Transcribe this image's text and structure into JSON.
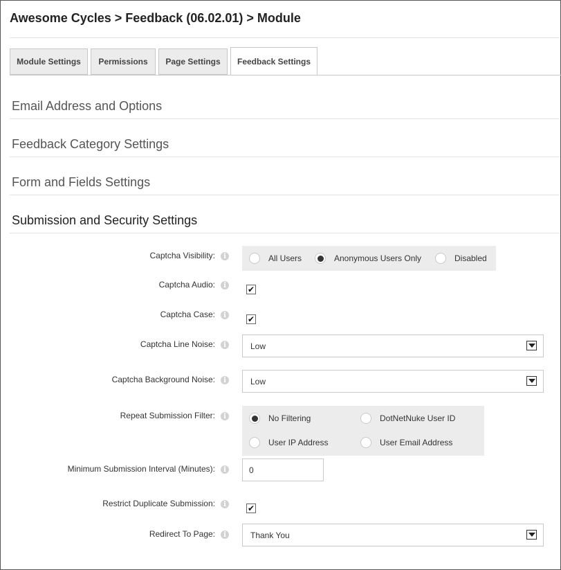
{
  "header": {
    "title": "Awesome Cycles > Feedback (06.02.01) > Module"
  },
  "tabs": [
    {
      "label": "Module Settings"
    },
    {
      "label": "Permissions"
    },
    {
      "label": "Page Settings"
    },
    {
      "label": "Feedback Settings",
      "active": true
    }
  ],
  "sections": [
    {
      "label": "Email Address and Options"
    },
    {
      "label": "Feedback Category Settings"
    },
    {
      "label": "Form and Fields Settings"
    },
    {
      "label": "Submission and Security Settings",
      "expanded": true
    }
  ],
  "form": {
    "captcha_visibility": {
      "label": "Captcha Visibility:",
      "options": [
        "All Users",
        "Anonymous Users Only",
        "Disabled"
      ],
      "selected": "Anonymous Users Only"
    },
    "captcha_audio": {
      "label": "Captcha Audio:",
      "checked": true
    },
    "captcha_case": {
      "label": "Captcha Case:",
      "checked": true
    },
    "captcha_line_noise": {
      "label": "Captcha Line Noise:",
      "value": "Low"
    },
    "captcha_background_noise": {
      "label": "Captcha Background Noise:",
      "value": "Low"
    },
    "repeat_submission_filter": {
      "label": "Repeat Submission Filter:",
      "options": [
        "No Filtering",
        "DotNetNuke User ID",
        "User IP Address",
        "User Email Address"
      ],
      "selected": "No Filtering"
    },
    "minimum_submission_interval": {
      "label": "Minimum Submission Interval (Minutes):",
      "value": "0"
    },
    "restrict_duplicate_submission": {
      "label": "Restrict Duplicate Submission:",
      "checked": true
    },
    "redirect_to_page": {
      "label": "Redirect To Page:",
      "value": "Thank You"
    }
  },
  "icons": {
    "info": "info-icon",
    "checkmark": "✔"
  },
  "colors": {
    "group_bg": "#ececec",
    "border": "#c9c9c9",
    "text": "#333333"
  }
}
